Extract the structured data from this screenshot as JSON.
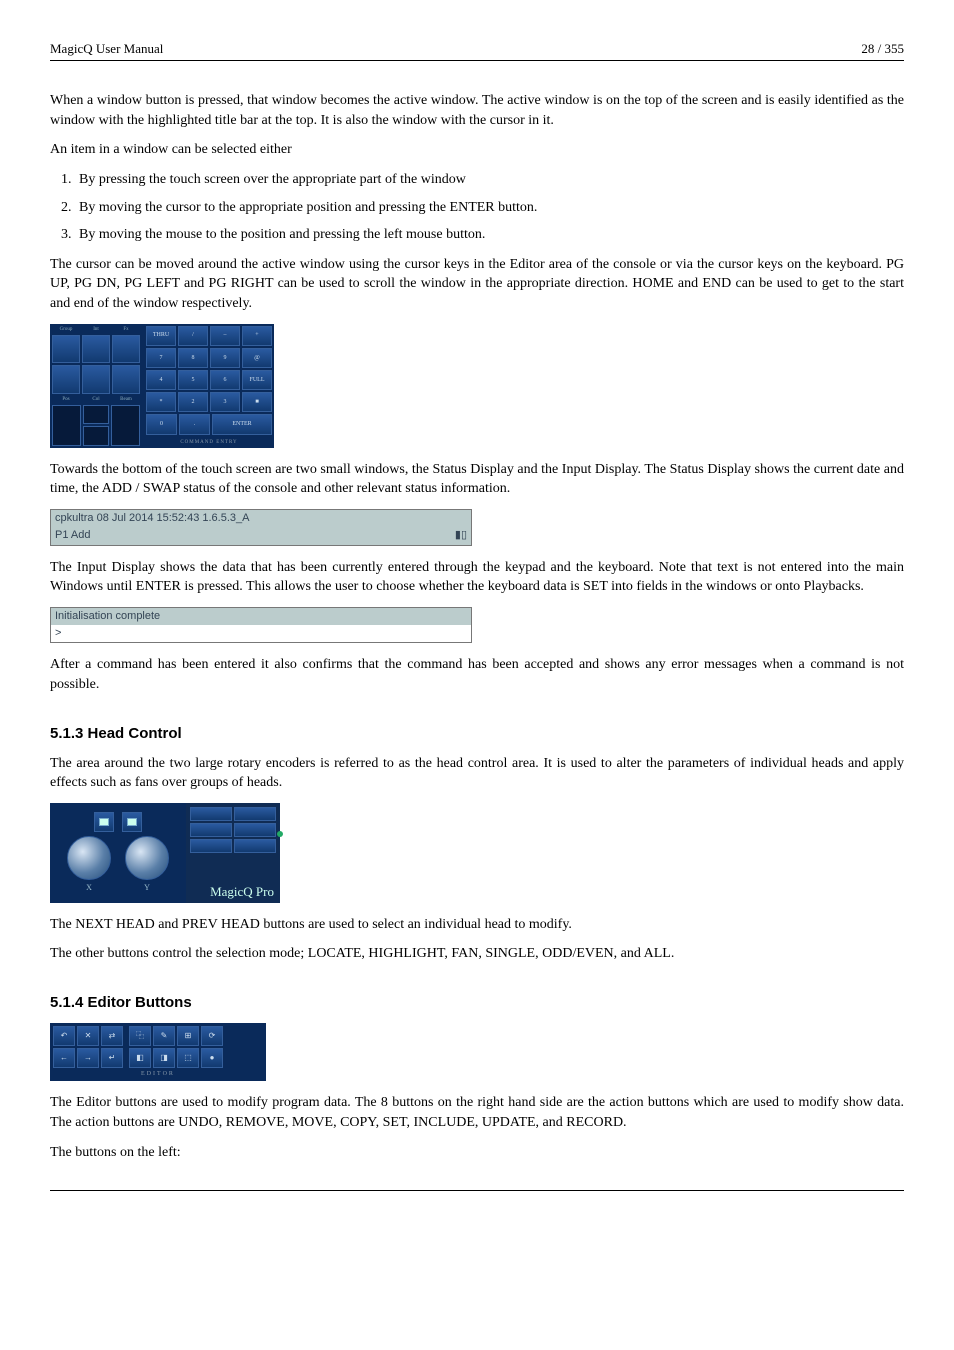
{
  "header": {
    "left": "MagicQ User Manual",
    "right": "28 / 355"
  },
  "p1": "When a window button is pressed, that window becomes the active window. The active window is on the top of the screen and is easily identified as the window with the highlighted title bar at the top. It is also the window with the cursor in it.",
  "p2": "An item in a window can be selected either",
  "list": [
    "By pressing the touch screen over the appropriate part of the window",
    "By moving the cursor to the appropriate position and pressing the ENTER button.",
    "By moving the mouse to the position and pressing the left mouse button."
  ],
  "p3": "The cursor can be moved around the active window using the cursor keys in the Editor area of the console or via the cursor keys on the keyboard. PG UP, PG DN, PG LEFT and PG RIGHT can be used to scroll the window in the appropriate direction. HOME and END can be used to get to the start and end of the window respectively.",
  "keypad": {
    "left_hdr": [
      "Group",
      "Int",
      "Fx"
    ],
    "left_hdr2": [
      "Pos",
      "Col",
      "Beam"
    ],
    "footer": "COMMAND ENTRY",
    "right_rows": [
      [
        "THRU",
        "/",
        "–",
        "+"
      ],
      [
        "7",
        "8",
        "9",
        "@"
      ],
      [
        "4",
        "5",
        "6",
        "FULL"
      ],
      [
        "*",
        "2",
        "3",
        "■"
      ],
      [
        "0",
        ".",
        "ENTER"
      ]
    ]
  },
  "p4": "Towards the bottom of the touch screen are two small windows, the Status Display and the Input Display. The Status Display shows the current date and time, the ADD / SWAP status of the console and other relevant status information.",
  "status1": {
    "line1": "cpkultra 08 Jul 2014 15:52:43 1.6.5.3_A",
    "line2": "P1 Add",
    "icons": "▮▯"
  },
  "p5": "The Input Display shows the data that has been currently entered through the keypad and the keyboard. Note that text is not entered into the main Windows until ENTER is pressed. This allows the user to choose whether the keyboard data is SET into fields in the windows or onto Playbacks.",
  "status2": {
    "line1": "Initialisation complete",
    "line2": ">"
  },
  "p6": "After a command has been entered it also confirms that the command has been accepted and shows any error messages when a command is not possible.",
  "sec513": {
    "title": "5.1.3   Head Control"
  },
  "p7": "The area around the two large rotary encoders is referred to as the head control area. It is used to alter the parameters of individual heads and apply effects such as fans over groups of heads.",
  "headctrl": {
    "x": "X",
    "y": "Y",
    "brand": "MagicQ Pro"
  },
  "p8": "The NEXT HEAD and PREV HEAD buttons are used to select an individual head to modify.",
  "p9": "The other buttons control the selection mode; LOCATE, HIGHLIGHT, FAN, SINGLE, ODD/EVEN, and ALL.",
  "sec514": {
    "title": "5.1.4   Editor Buttons"
  },
  "editor": {
    "footer": "EDITOR"
  },
  "p10": "The Editor buttons are used to modify program data. The 8 buttons on the right hand side are the action buttons which are used to modify show data. The action buttons are UNDO, REMOVE, MOVE, COPY, SET, INCLUDE, UPDATE, and RECORD.",
  "p11": "The buttons on the left:"
}
